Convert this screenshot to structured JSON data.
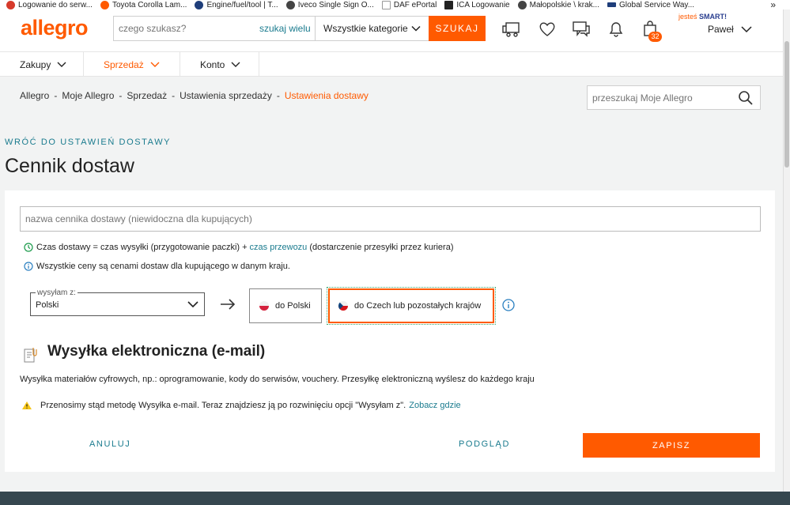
{
  "bookmarks": [
    {
      "label": "Logowanie do serw...",
      "color": "#d63a2b"
    },
    {
      "label": "Toyota Corolla Lam...",
      "color": "#ff5a00"
    },
    {
      "label": "Engine/fuel/tool | T...",
      "color": "#1f3e7a"
    },
    {
      "label": "Iveco Single Sign O...",
      "color": "#444444"
    },
    {
      "label": "DAF ePortal",
      "color": "#1c1c1c"
    },
    {
      "label": "ICA Logowanie",
      "color": "#222222"
    },
    {
      "label": "Małopolskie \\ krak...",
      "color": "#444444"
    },
    {
      "label": "Global Service Way...",
      "color": "#1f3e7a"
    }
  ],
  "bookmarks_more": "»",
  "header": {
    "logo": "allegro",
    "search_placeholder": "czego szukasz?",
    "search_many": "szukaj wielu",
    "category": "Wszystkie kategorie",
    "search_button": "SZUKAJ",
    "cart_count": "32",
    "smart_prefix": "jesteś",
    "smart_label": "SMART!",
    "user_name": "Paweł"
  },
  "nav": {
    "tabs": [
      {
        "label": "Zakupy"
      },
      {
        "label": "Sprzedaż"
      },
      {
        "label": "Konto"
      }
    ]
  },
  "breadcrumb": {
    "items": [
      "Allegro",
      "Moje Allegro",
      "Sprzedaż",
      "Ustawienia sprzedaży"
    ],
    "current": "Ustawienia dostawy",
    "separator": "-",
    "search_placeholder": "przeszukaj Moje Allegro"
  },
  "page": {
    "back_link": "WRÓĆ DO USTAWIEŃ DOSTAWY",
    "title": "Cennik dostaw"
  },
  "form": {
    "name_placeholder": "nazwa cennika dostawy (niewidoczna dla kupujących)",
    "info_time_a": "Czas dostawy = czas wysyłki (przygotowanie paczki) +",
    "info_time_link": "czas przewozu",
    "info_time_b": "(dostarczenie przesyłki przez kuriera)",
    "info_prices": "Wszystkie ceny są cenami dostaw dla kupującego w danym kraju.",
    "ship_from_label": "wysyłam z:",
    "ship_from_value": "Polski",
    "dest_poland": "do Polski",
    "dest_czech": "do Czech lub pozostałych krajów",
    "section_title": "Wysyłka elektroniczna (e-mail)",
    "section_desc": "Wysyłka materiałów cyfrowych, np.: oprogramowanie, kody do serwisów, vouchery. Przesyłkę elektroniczną wyślesz do każdego kraju",
    "warning_text": "Przenosimy stąd metodę Wysyłka e-mail. Teraz znajdziesz ją po rozwinięciu opcji \"Wysyłam z\".",
    "warning_link": "Zobacz gdzie",
    "cancel": "ANULUJ",
    "preview": "PODGLĄD",
    "save": "ZAPISZ"
  },
  "colors": {
    "accent": "#ff5a00",
    "link": "#1a7b8e",
    "footer": "#36474f"
  }
}
